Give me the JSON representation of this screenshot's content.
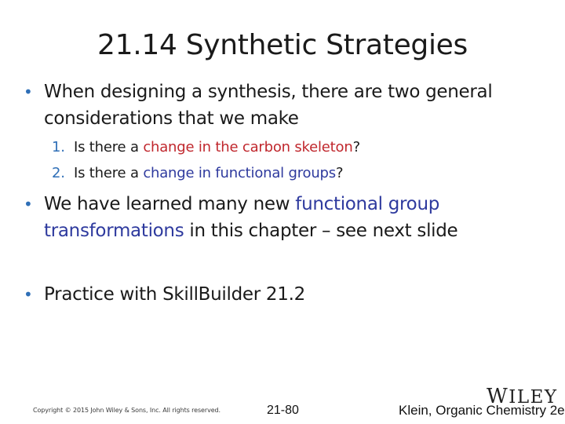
{
  "slide": {
    "title": "21.14 Synthetic Strategies",
    "bullets": [
      {
        "marker": "•",
        "line1": "When designing a synthesis, there are two general",
        "line2": "considerations that we make"
      },
      {
        "marker": "•",
        "pre": "We have learned many new ",
        "highlight1": "functional group",
        "highlight2": "transformations",
        "post": " in this chapter – see next slide"
      },
      {
        "marker": "•",
        "text": "Practice with SkillBuilder 21.2"
      }
    ],
    "subitems": [
      {
        "number": "1.",
        "pre": "Is there a ",
        "highlight": "change in the carbon skeleton",
        "post": "?"
      },
      {
        "number": "2.",
        "pre": "Is there a ",
        "highlight": "change in functional groups",
        "post": "?"
      }
    ]
  },
  "footer": {
    "copyright": "Copyright © 2015 John Wiley & Sons, Inc. All rights reserved.",
    "page": "21-80",
    "reference": "Klein, Organic Chemistry 2e",
    "logo_first": "W",
    "logo_rest": "ILEY"
  },
  "colors": {
    "bullet": "#2f6fb7",
    "red_highlight": "#c0272d",
    "blue_highlight": "#2e3a9e"
  }
}
